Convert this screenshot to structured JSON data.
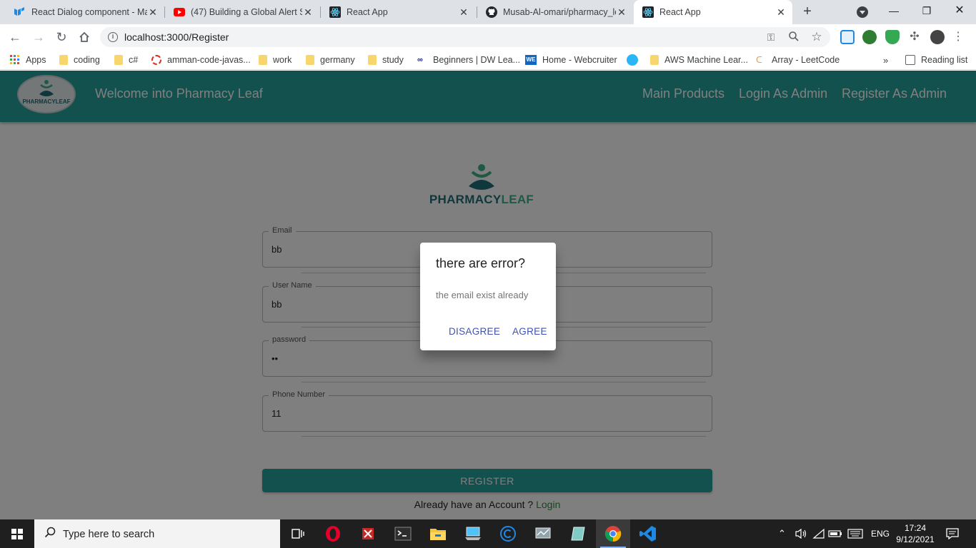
{
  "tabs": [
    {
      "title": "React Dialog component - Ma",
      "icon": "mui-icon"
    },
    {
      "title": "(47) Building a Global Alert Sy",
      "icon": "youtube-icon"
    },
    {
      "title": "React App",
      "icon": "react-icon"
    },
    {
      "title": "Musab-Al-omari/pharmacy_le",
      "icon": "github-icon"
    },
    {
      "title": "React App",
      "icon": "react-icon",
      "active": true
    }
  ],
  "address_bar": {
    "url": "localhost:3000/Register"
  },
  "bookmarks": {
    "apps": "Apps",
    "items": [
      "coding",
      "c#",
      "amman-code-javas...",
      "work",
      "germany",
      "study",
      "Beginners | DW Lea...",
      "Home - Webcruiter",
      "AWS Machine Lear...",
      "Array - LeetCode"
    ],
    "more": "»",
    "reading_list": "Reading list"
  },
  "app": {
    "logo_text": "PHARMACYLEAF",
    "title": "Welcome into Pharmacy Leaf",
    "nav": [
      "Main Products",
      "Login As Admin",
      "Register As Admin"
    ]
  },
  "form": {
    "brand_part1": "PHARMACY",
    "brand_part2": "LEAF",
    "fields": [
      {
        "label": "Email",
        "value": "bb"
      },
      {
        "label": "User Name",
        "value": "bb"
      },
      {
        "label": "password",
        "value": "••"
      },
      {
        "label": "Phone Number",
        "value": "11"
      }
    ],
    "submit": "REGISTER",
    "footer_text": "Already have an Account ?",
    "footer_link": "Login"
  },
  "dialog": {
    "title": "there are error?",
    "message": "the email exist already",
    "disagree": "DISAGREE",
    "agree": "AGREE"
  },
  "taskbar": {
    "search_placeholder": "Type here to search",
    "language": "ENG",
    "time": "17:24",
    "date": "9/12/2021"
  },
  "colors": {
    "brand_teal": "#26a39e",
    "dialog_action": "#3f51b5",
    "login_link": "#2a8f3c"
  }
}
